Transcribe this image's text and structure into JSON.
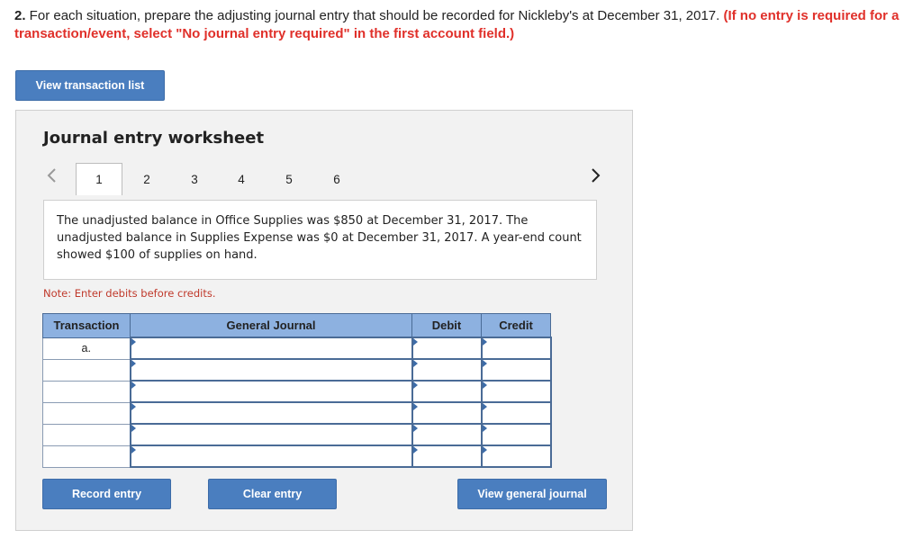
{
  "question": {
    "number": "2.",
    "text": " For each situation, prepare the adjusting journal entry that should be recorded for Nickleby's at December 31, 2017. ",
    "instruction": "(If no entry is required for a transaction/event, select \"No journal entry required\" in the first account field.)"
  },
  "view_transaction_list_label": "View transaction list",
  "worksheet": {
    "title": "Journal entry worksheet",
    "tabs": [
      "1",
      "2",
      "3",
      "4",
      "5",
      "6"
    ],
    "active_tab": 0,
    "description": "The unadjusted balance in Office Supplies was $850 at December 31, 2017. The unadjusted balance in Supplies Expense was $0 at December 31, 2017. A year-end count showed $100 of supplies on hand.",
    "note": "Note: Enter debits before credits.",
    "table": {
      "headers": [
        "Transaction",
        "General Journal",
        "Debit",
        "Credit"
      ],
      "rows": [
        {
          "transaction": "a."
        },
        {
          "transaction": ""
        },
        {
          "transaction": ""
        },
        {
          "transaction": ""
        },
        {
          "transaction": ""
        },
        {
          "transaction": ""
        }
      ]
    },
    "buttons": {
      "record": "Record entry",
      "clear": "Clear entry",
      "view_journal": "View general journal"
    }
  },
  "icons": {
    "prev": "chevron-left-icon",
    "next": "chevron-right-icon"
  },
  "colors": {
    "accent": "#4a7ebf",
    "header": "#8db1e0",
    "instruction": "#e0302a"
  }
}
